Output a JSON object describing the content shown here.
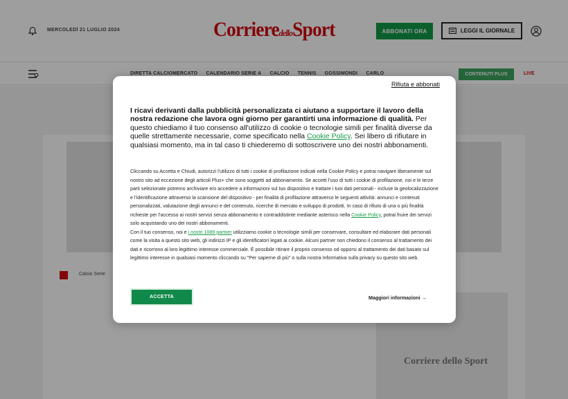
{
  "header": {
    "date": "MERCOLEDÌ 21 LUGLIO 2024",
    "logo_main": "Corriere",
    "logo_mid": "dello",
    "logo_end": "Sport",
    "subscribe_label": "ABBONATI ORA",
    "read_label": "LEGGI IL GIORNALE"
  },
  "nav": {
    "items": [
      "DIRETTA CALCIOMERCATO",
      "CALENDARIO SERIE A",
      "CALCIO",
      "TENNIS",
      "GOSSIMONDI",
      "CARLO"
    ],
    "plus_label": "CONTENUTI PLUS",
    "live_label": "LIVE"
  },
  "breadcrumb": {
    "text": "Calcio   Serie"
  },
  "sidebar": {
    "logo": "Corriere dello Sport"
  },
  "consent": {
    "reject_label": "Rifiuta e abbonati",
    "lead_bold": "I ricavi derivanti dalla pubblicità personalizzata ci aiutano a supportare il lavoro della nostra redazione che lavora ogni giorno per garantirti una informazione di qualità.",
    "lead_text1": " Per questo chiediamo il tuo consenso all'utilizzo di cookie o tecnologie simili per finalità diverse da quelle strettamente necessarie, come specificato nella ",
    "cookie_policy_label": "Cookie Policy",
    "lead_text2": ". Sei libero di rifiutare in qualsiasi momento, ma in tal caso ti chiederemo di sottoscrivere uno dei nostri abbonamenti.",
    "details_p1a": "Cliccando su Accetta e Chiudi, autorizzi l'utilizzo di tutti i cookie di profilazione indicati nella Cookie Policy e potrai navigare liberamente sul nostro sito ad eccezione degli articoli Plus+ che sono soggetti ad abbonamento. Se accetti l'uso di tutti i cookie di profilazione, noi e le terze parti selezionate potremo archiviare e/o accedere a informazioni sul tuo dispositivo e trattare i tuoi dati personali - incluse la geolocalizzazione e l'identificazione attraverso la scansione del dispositivo - per finalità di profilazione attraverso le seguenti attività: annunci e contenuti personalizzati, valutazione degli annunci e del contenuto, ricerche di mercato e sviluppo di prodotti. In caso di rifiuto di una o più finalità richieste per l'accesso ai nostri servizi senza abbonamento e contraddistinte mediante asterisco nella ",
    "details_p1_link": "Cookie Policy",
    "details_p1b": ", potrai fruire dei servizi solo acquistando uno dei nostri abbonamenti.",
    "details_p2a": "Con il tuo consenso, noi e ",
    "partners_link": "i nostri 1089 partner",
    "details_p2b": " utilizziamo cookie o tecnologie simili per conservare, consultare ed elaborare dati personali come la visita a questo sito web, gli indirizzi IP e gli identificatori legati ai cookie. Alcuni partner non chiedono il consenso al trattamento dei dati e ricorrono al loro legittimo interesse commerciale. È possibile ritirare il proprio consenso od opporsi al trattamento dei dati basato sul legittimo interesse in qualsiasi momento cliccando su \"Per saperne di più\" o sulla nostra Informativa sulla privacy su questo sito web.",
    "accept_label": "ACCETTA",
    "more_info_label": "Maggiori informazioni →"
  }
}
